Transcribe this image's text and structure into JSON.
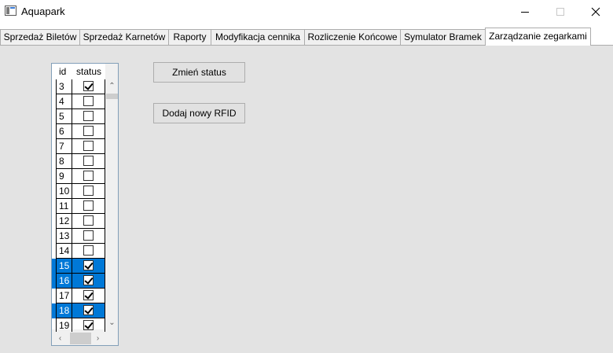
{
  "window": {
    "title": "Aquapark",
    "minimize_icon": "minimize-icon",
    "maximize_icon": "maximize-icon",
    "close_glyph": "✕"
  },
  "tabs": [
    {
      "label": "Sprzedaż Biletów",
      "active": false
    },
    {
      "label": "Sprzedaż Karnetów",
      "active": false
    },
    {
      "label": "Raporty",
      "active": false
    },
    {
      "label": "Modyfikacja cennika",
      "active": false
    },
    {
      "label": "Rozliczenie Końcowe",
      "active": false
    },
    {
      "label": "Symulator Bramek",
      "active": false
    },
    {
      "label": "Zarządzanie zegarkami",
      "active": true
    }
  ],
  "grid": {
    "columns": {
      "id": "id",
      "status": "status"
    },
    "rows": [
      {
        "id": "3",
        "status": true,
        "selected": false
      },
      {
        "id": "4",
        "status": false,
        "selected": false
      },
      {
        "id": "5",
        "status": false,
        "selected": false
      },
      {
        "id": "6",
        "status": false,
        "selected": false
      },
      {
        "id": "7",
        "status": false,
        "selected": false
      },
      {
        "id": "8",
        "status": false,
        "selected": false
      },
      {
        "id": "9",
        "status": false,
        "selected": false
      },
      {
        "id": "10",
        "status": false,
        "selected": false
      },
      {
        "id": "11",
        "status": false,
        "selected": false
      },
      {
        "id": "12",
        "status": false,
        "selected": false
      },
      {
        "id": "13",
        "status": false,
        "selected": false
      },
      {
        "id": "14",
        "status": false,
        "selected": false
      },
      {
        "id": "15",
        "status": true,
        "selected": true
      },
      {
        "id": "16",
        "status": true,
        "selected": true
      },
      {
        "id": "17",
        "status": true,
        "selected": false
      },
      {
        "id": "18",
        "status": true,
        "selected": true
      },
      {
        "id": "19",
        "status": true,
        "selected": false
      }
    ],
    "selection_color": "#0078d7"
  },
  "buttons": {
    "change_status": "Zmień status",
    "add_rfid": "Dodaj nowy RFID"
  }
}
